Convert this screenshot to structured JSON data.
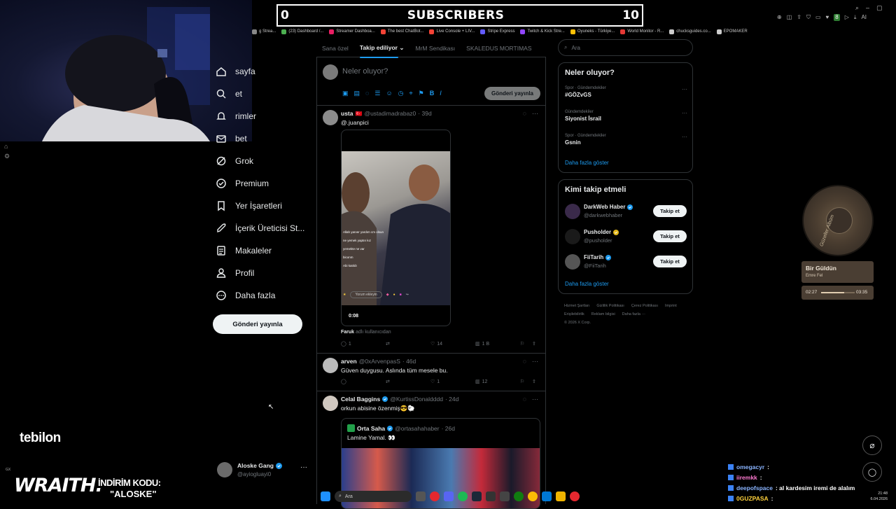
{
  "overlay": {
    "sub_left": "0",
    "sub_title": "SUBSCRIBERS",
    "sub_right": "10"
  },
  "bookmarks": [
    {
      "label": "g Strea...",
      "color": "#888"
    },
    {
      "label": "(23) Dashboard /...",
      "color": "#4caf50"
    },
    {
      "label": "Streamer Dashboa...",
      "color": "#e91e63"
    },
    {
      "label": "The best ChatBot...",
      "color": "#f44336"
    },
    {
      "label": "Live Console + LIV...",
      "color": "#f44336"
    },
    {
      "label": "Stripe Express",
      "color": "#635bff"
    },
    {
      "label": "Twitch & Kick Stre...",
      "color": "#9146ff"
    },
    {
      "label": "Oyuneks - Türkiye...",
      "color": "#ffc107"
    },
    {
      "label": "World Monitor - R...",
      "color": "#e53935"
    },
    {
      "label": "chucksguides.co...",
      "color": "#ccc"
    },
    {
      "label": "EPOMAKER",
      "color": "#ccc"
    }
  ],
  "browser": {
    "ai_label": "AI"
  },
  "nav": {
    "items": [
      {
        "label": "sayfa",
        "icon": "home-icon"
      },
      {
        "label": "et",
        "icon": "explore-icon"
      },
      {
        "label": "rimler",
        "icon": "bell-icon"
      },
      {
        "label": "bet",
        "icon": "mail-icon"
      },
      {
        "label": "Grok",
        "icon": "grok-icon"
      },
      {
        "label": "Premium",
        "icon": "premium-icon"
      },
      {
        "label": "Yer İşaretleri",
        "icon": "bookmark-icon"
      },
      {
        "label": "İçerik Üreticisi St...",
        "icon": "rocket-icon"
      },
      {
        "label": "Makaleler",
        "icon": "article-icon"
      },
      {
        "label": "Profil",
        "icon": "profile-icon"
      },
      {
        "label": "Daha fazla",
        "icon": "more-icon"
      }
    ],
    "post_button": "Gönderi yayınla",
    "account": {
      "name": "Aloske Gang",
      "handle": "@ayiogluayi0"
    }
  },
  "tabs": [
    "Sana özel",
    "Takip ediliyor",
    "MrM Sendikası",
    "SKALEDUS MORTIMAS"
  ],
  "composer": {
    "placeholder": "Neler oluyor?",
    "post_button": "Gönderi yayınla"
  },
  "posts": [
    {
      "name": "usta",
      "flag": "🇹🇷",
      "handle": "@ustadimadrabaz0",
      "time": "· 39d",
      "text": "@.juanpici",
      "video": {
        "time": "0:08",
        "chat": [
          "Allah yarver yardım cm olsun",
          "ne yemek yaptın kız",
          "yemekte ne var",
          "biconm",
          "Abi katıldı"
        ],
        "comment_placeholder": "Yorum ekleyin"
      },
      "attribution_name": "Faruk",
      "attribution_text": "adlı kullanıcıdan",
      "stats": {
        "replies": "1",
        "reposts": "",
        "likes": "14",
        "views": "1 B"
      }
    },
    {
      "name": "arven",
      "handle": "@0xArvenpasS",
      "time": "· 46d",
      "text": "Güven duygusu. Aslında tüm mesele bu.",
      "stats": {
        "replies": "",
        "reposts": "",
        "likes": "1",
        "views": "12"
      }
    },
    {
      "name": "Celal Baggins",
      "handle": "@KurtissDonaldddd",
      "time": "· 24d",
      "text": "orkun abisine özenmiş😎🐑",
      "quote": {
        "name": "Orta Saha",
        "handle": "@ortasahahaber",
        "time": "· 26d",
        "text": "Lamine Yamal. 👀"
      }
    }
  ],
  "search": {
    "placeholder": "Ara"
  },
  "trends": {
    "title": "Neler oluyor?",
    "items": [
      {
        "category": "Spor · Gündemdekiler",
        "title": "#GÖZvGS"
      },
      {
        "category": "Gündemdekiler",
        "title": "Siyonist İsrail"
      },
      {
        "category": "Spor · Gündemdekiler",
        "title": "Gsnin"
      }
    ],
    "more": "Daha fazla göster"
  },
  "follow": {
    "title": "Kimi takip etmeli",
    "items": [
      {
        "name": "DarkWeb Haber",
        "handle": "@darkwebhaber",
        "badge": "blue",
        "button": "Takip et"
      },
      {
        "name": "Pusholder",
        "handle": "@pusholder",
        "badge": "gold",
        "button": "Takip et"
      },
      {
        "name": "FiiTarih",
        "handle": "@FiiTarih",
        "badge": "blue",
        "button": "Takip et"
      }
    ],
    "more": "Daha fazla göster"
  },
  "footer": {
    "links": [
      "Hizmet Şartları",
      "Gizlilik Politikası",
      "Çerez Politikası",
      "Imprint",
      "Erişilebilirlik",
      "Reklam bilgisi",
      "Daha fazla ···"
    ],
    "copyright": "© 2026 X Corp."
  },
  "music": {
    "title": "Bir Güldün",
    "artist": "Emre Fel",
    "elapsed": "02:27",
    "total": "03:35",
    "progress": 0.68,
    "art_text": "Güzeller Albüm"
  },
  "chat": [
    {
      "user": "omegacyr",
      "text": ":",
      "color": "#8ab4ff"
    },
    {
      "user": "iiremkk",
      "text": ":",
      "color": "#ff7ad1"
    },
    {
      "user": "deepofspace",
      "text": ": al kardesim iremi de alalım",
      "color": "#8ab4ff"
    },
    {
      "user": "0GUZPASA",
      "text": ":",
      "color": "#ffd23d"
    }
  ],
  "branding": {
    "tebilon": "tebilon",
    "wraith": "WRAITH.",
    "discount_label": "İNDİRİM KODU:",
    "discount_code": "\"ALOSKE\"",
    "gx": "GX"
  },
  "taskbar": {
    "search": "Ara",
    "time": "21:48",
    "date": "6.04.2026"
  }
}
